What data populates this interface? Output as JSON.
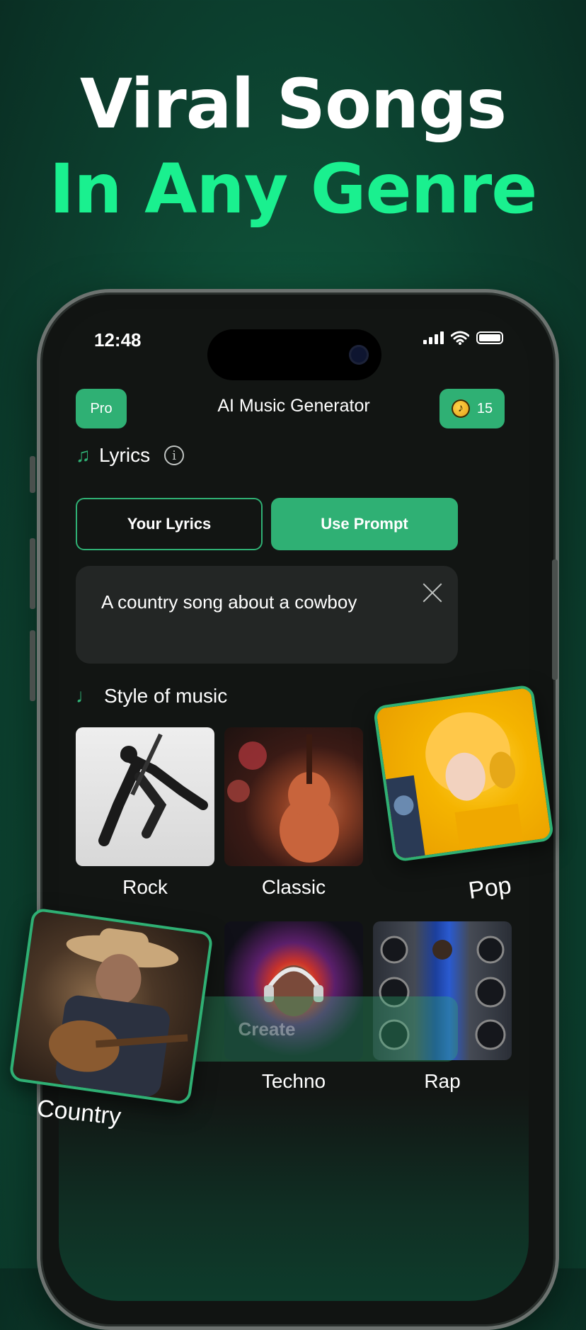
{
  "headline": {
    "line1": "Viral Songs",
    "line2": "In Any Genre"
  },
  "status_bar": {
    "time": "12:48"
  },
  "app": {
    "pro_label": "Pro",
    "title": "AI Music Generator",
    "coins": "15"
  },
  "lyrics": {
    "section_label": "Lyrics",
    "tabs": {
      "your_lyrics": "Your Lyrics",
      "use_prompt": "Use Prompt"
    },
    "active_tab": "Use Prompt",
    "prompt_value": "A country song about a cowboy"
  },
  "style": {
    "section_label": "Style of music",
    "genres": {
      "rock": "Rock",
      "classic": "Classic",
      "pop": "Pop",
      "country": "Country",
      "techno": "Techno",
      "rap": "Rap"
    }
  },
  "create_label": "Create",
  "colors": {
    "accent": "#2fb074",
    "headline_green": "#1af08f",
    "background": "#105a3d"
  },
  "icons": [
    "music-note-icon",
    "info-icon",
    "close-icon",
    "coin-icon",
    "wifi-icon",
    "signal-icon",
    "battery-icon"
  ]
}
